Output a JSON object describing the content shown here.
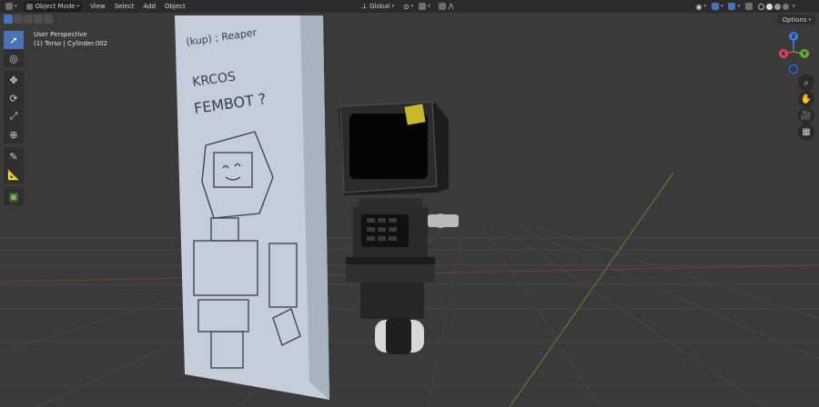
{
  "header": {
    "mode_label": "Object Mode",
    "menus": [
      "View",
      "Select",
      "Add",
      "Object"
    ],
    "transform_orientation": "Global",
    "options_label": "Options"
  },
  "viewport": {
    "perspective_label": "User Perspective",
    "object_label": "(1) Torso | Cylinder.002"
  },
  "gizmo": {
    "z_label": "Z",
    "y_label": "Y",
    "x_label": "X"
  },
  "scene": {
    "sketch_text_line1": "(kup) ; Reaper",
    "sketch_text_line2": "KRCOS",
    "sketch_text_line3": "FEMBOT ?"
  },
  "colors": {
    "accent": "#4a72b8",
    "header_bg": "#2b2b2b",
    "viewport_bg": "#3a3a3a",
    "axis_x": "#e0445a",
    "axis_y": "#6aab2a",
    "axis_z": "#3d7fe0"
  },
  "icons": [
    "editor-type-icon",
    "object-mode-icon",
    "select-box-icon",
    "cursor-icon",
    "move-icon",
    "rotate-icon",
    "scale-icon",
    "transform-icon",
    "annotate-icon",
    "measure-icon",
    "add-cube-icon",
    "zoom-icon",
    "pan-hand-icon",
    "camera-icon",
    "grid-view-icon"
  ]
}
